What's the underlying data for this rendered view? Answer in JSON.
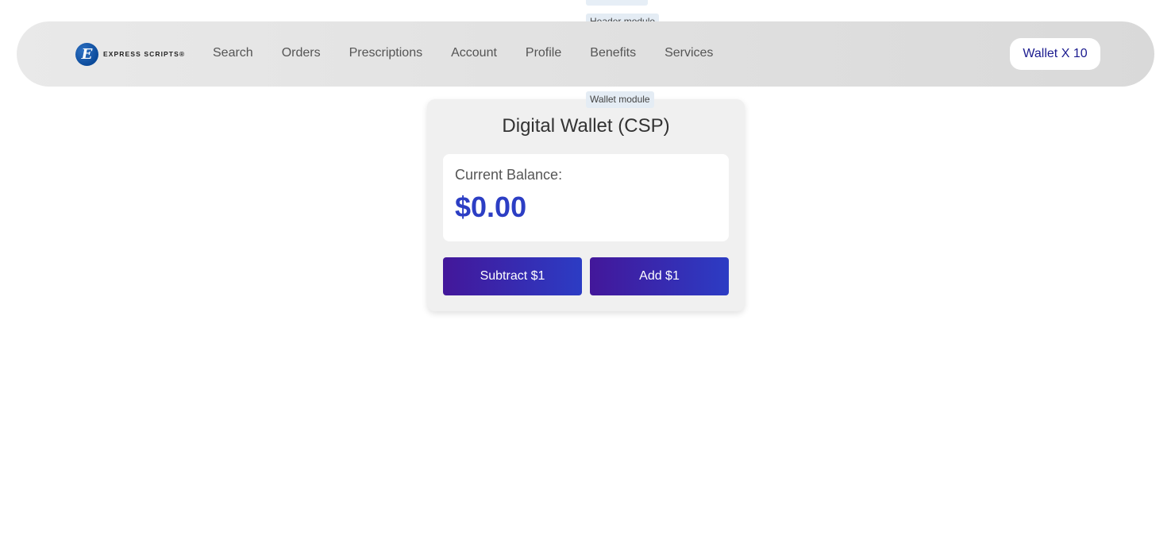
{
  "labels": {
    "header_module": "Header module",
    "wallet_module": "Wallet module"
  },
  "header": {
    "logo_text": "EXPRESS SCRIPTS®",
    "logo_mark": "E",
    "nav": [
      "Search",
      "Orders",
      "Prescriptions",
      "Account",
      "Profile",
      "Benefits",
      "Services"
    ],
    "wallet_button": "Wallet X 10"
  },
  "wallet": {
    "title": "Digital Wallet (CSP)",
    "balance_label": "Current Balance:",
    "balance_value": "$0.00",
    "subtract_label": "Subtract $1",
    "add_label": "Add $1"
  },
  "colors": {
    "accent": "#2c3ec4",
    "button_gradient_start": "#43179a",
    "button_gradient_end": "#2c3cc4",
    "wallet_text": "#1b1b8f"
  },
  "icons": {
    "logo": "express-scripts-logo-icon"
  }
}
